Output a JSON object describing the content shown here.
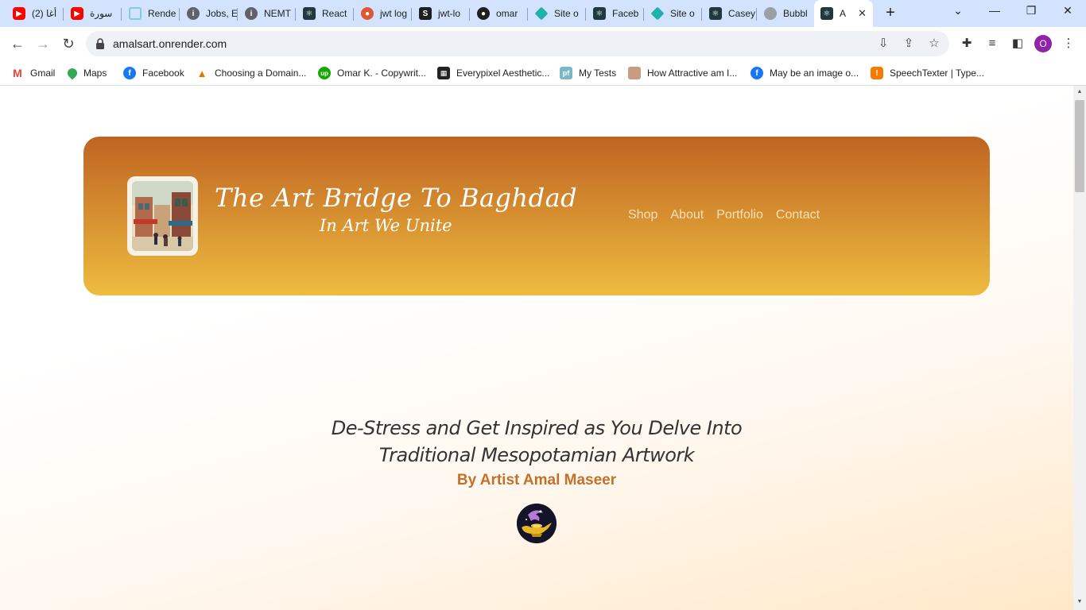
{
  "browser": {
    "tabs": [
      {
        "label": "(2) أغا",
        "icon": "youtube-icon",
        "color": "#ff0000"
      },
      {
        "label": "سورة",
        "icon": "youtube-icon",
        "color": "#ff0000"
      },
      {
        "label": "Rende",
        "icon": "render-icon",
        "color": "#7fcfd6"
      },
      {
        "label": "Jobs, E",
        "icon": "info-icon",
        "color": "#5f6368"
      },
      {
        "label": "NEMT",
        "icon": "info-icon",
        "color": "#5f6368"
      },
      {
        "label": "React",
        "icon": "react-icon",
        "color": "#1e3a3f"
      },
      {
        "label": "jwt log",
        "icon": "duckduckgo-icon",
        "color": "#de5833"
      },
      {
        "label": "jwt-lo",
        "icon": "scribd-icon",
        "color": "#1f1f1f"
      },
      {
        "label": "omar",
        "icon": "github-icon",
        "color": "#1f1f1f"
      },
      {
        "label": "Site o",
        "icon": "netlify-icon",
        "color": "#20b2aa"
      },
      {
        "label": "Faceb",
        "icon": "react-icon",
        "color": "#1e3a3f"
      },
      {
        "label": "Site o",
        "icon": "netlify-icon",
        "color": "#20b2aa"
      },
      {
        "label": "Casey",
        "icon": "react-icon",
        "color": "#1e3a3f"
      },
      {
        "label": "Bubbl",
        "icon": "globe-icon",
        "color": "#9aa0a6"
      },
      {
        "label": "A",
        "icon": "react-icon",
        "color": "#1e3a3f",
        "active": true
      }
    ],
    "url": "amalsart.onrender.com",
    "profile_initial": "O",
    "bookmarks": [
      {
        "label": "Gmail",
        "icon": "gmail-icon",
        "color": "#ea4335"
      },
      {
        "label": "Maps",
        "icon": "maps-icon",
        "color": "#34a853"
      },
      {
        "label": "Facebook",
        "icon": "facebook-icon",
        "color": "#1877f2"
      },
      {
        "label": "Choosing a Domain...",
        "icon": "domain-icon",
        "color": "#e37400"
      },
      {
        "label": "Omar K. - Copywrit...",
        "icon": "upwork-icon",
        "color": "#14a800"
      },
      {
        "label": "Everypixel Aesthetic...",
        "icon": "everypixel-icon",
        "color": "#222222"
      },
      {
        "label": "My Tests",
        "icon": "pf-icon",
        "color": "#7ab8c8"
      },
      {
        "label": "How Attractive am I...",
        "icon": "face-icon",
        "color": "#c89c80"
      },
      {
        "label": "May be an image o...",
        "icon": "facebook-icon",
        "color": "#1877f2"
      },
      {
        "label": "SpeechTexter | Type...",
        "icon": "speechtexter-icon",
        "color": "#f57c00"
      }
    ]
  },
  "site": {
    "title": "The Art Bridge To Baghdad",
    "tagline": "In Art We Unite",
    "nav": [
      "Shop",
      "About",
      "Portfolio",
      "Contact"
    ],
    "intro_line1": "De-Stress and Get Inspired as You Delve Into",
    "intro_line2": "Traditional Mesopotamian Artwork",
    "byline": "By Artist Amal Maseer",
    "colors": {
      "hero_top": "#bf6422",
      "hero_bottom": "#eebc40",
      "byline": "#c4702a",
      "nav": "#f6e2b8"
    }
  }
}
